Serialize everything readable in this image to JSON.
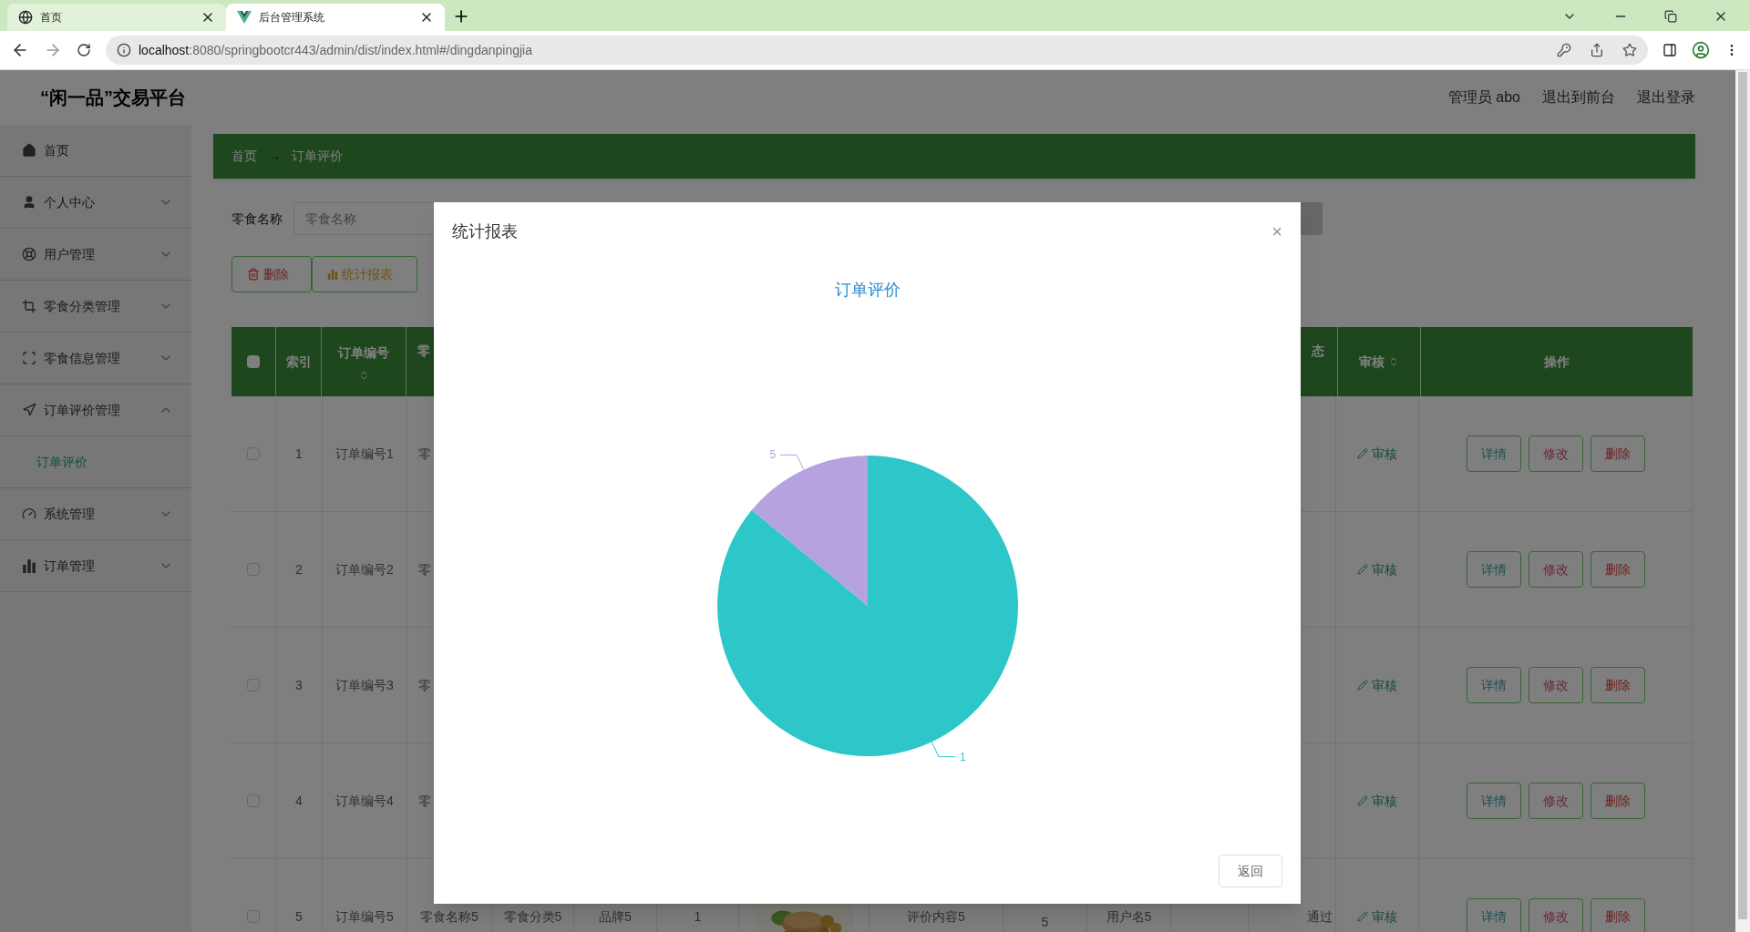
{
  "browser": {
    "tabs": [
      {
        "title": "首页",
        "selected": false
      },
      {
        "title": "后台管理系统",
        "selected": true
      }
    ],
    "url_host": "localhost",
    "url_rest": ":8080/springbootcr443/admin/dist/index.html#/dingdanpingjia"
  },
  "header": {
    "title": "“闲一品”交易平台",
    "links": [
      "管理员 abo",
      "退出到前台",
      "退出登录"
    ]
  },
  "sidebar": {
    "items": [
      {
        "label": "首页",
        "expandable": false
      },
      {
        "label": "个人中心",
        "expandable": true,
        "expanded": false
      },
      {
        "label": "用户管理",
        "expandable": true,
        "expanded": false
      },
      {
        "label": "零食分类管理",
        "expandable": true,
        "expanded": false
      },
      {
        "label": "零食信息管理",
        "expandable": true,
        "expanded": false
      },
      {
        "label": "订单评价管理",
        "expandable": true,
        "expanded": true,
        "children": [
          {
            "label": "订单评价",
            "selected": true
          }
        ]
      },
      {
        "label": "系统管理",
        "expandable": true,
        "expanded": false
      },
      {
        "label": "订单管理",
        "expandable": true,
        "expanded": false
      }
    ]
  },
  "breadcrumb": [
    "首页",
    "→",
    "订单评价"
  ],
  "search": {
    "label": "零食名称",
    "placeholder": "零食名称"
  },
  "actions": [
    "删除",
    "统计报表"
  ],
  "table": {
    "select_all_checked": false,
    "columns": [
      "索引",
      "订单编号",
      "零",
      "态",
      "审核",
      "操作"
    ],
    "rows": [
      {
        "checked": false,
        "index": "1",
        "order_no": "订单编号1",
        "name": "零",
        "audit": "审核",
        "buttons": [
          "详情",
          "修改",
          "删除"
        ]
      },
      {
        "checked": false,
        "index": "2",
        "order_no": "订单编号2",
        "name": "零",
        "audit": "审核",
        "buttons": [
          "详情",
          "修改",
          "删除"
        ]
      },
      {
        "checked": false,
        "index": "3",
        "order_no": "订单编号3",
        "name": "零",
        "audit": "审核",
        "buttons": [
          "详情",
          "修改",
          "删除"
        ]
      },
      {
        "checked": false,
        "index": "4",
        "order_no": "订单编号4",
        "name": "零",
        "audit": "审核",
        "buttons": [
          "详情",
          "修改",
          "删除"
        ]
      },
      {
        "checked": false,
        "index": "5",
        "order_no": "订单编号5",
        "name": "零食名称5",
        "category": "零食分类5",
        "brand": "品牌5",
        "column_6": "1",
        "review": "评价内容5",
        "rating": "5",
        "username": "用户名5",
        "status": "通过",
        "audit": "审核",
        "buttons": [
          "详情",
          "修改",
          "删除"
        ]
      }
    ]
  },
  "dialog": {
    "title": "统计报表",
    "close": "×",
    "button": "返回",
    "chart_data": {
      "type": "pie",
      "title": "订单评价",
      "categories": [
        "1",
        "5"
      ],
      "values": [
        86,
        14
      ],
      "colors": [
        "#2ec7c9",
        "#b6a2de"
      ]
    }
  }
}
